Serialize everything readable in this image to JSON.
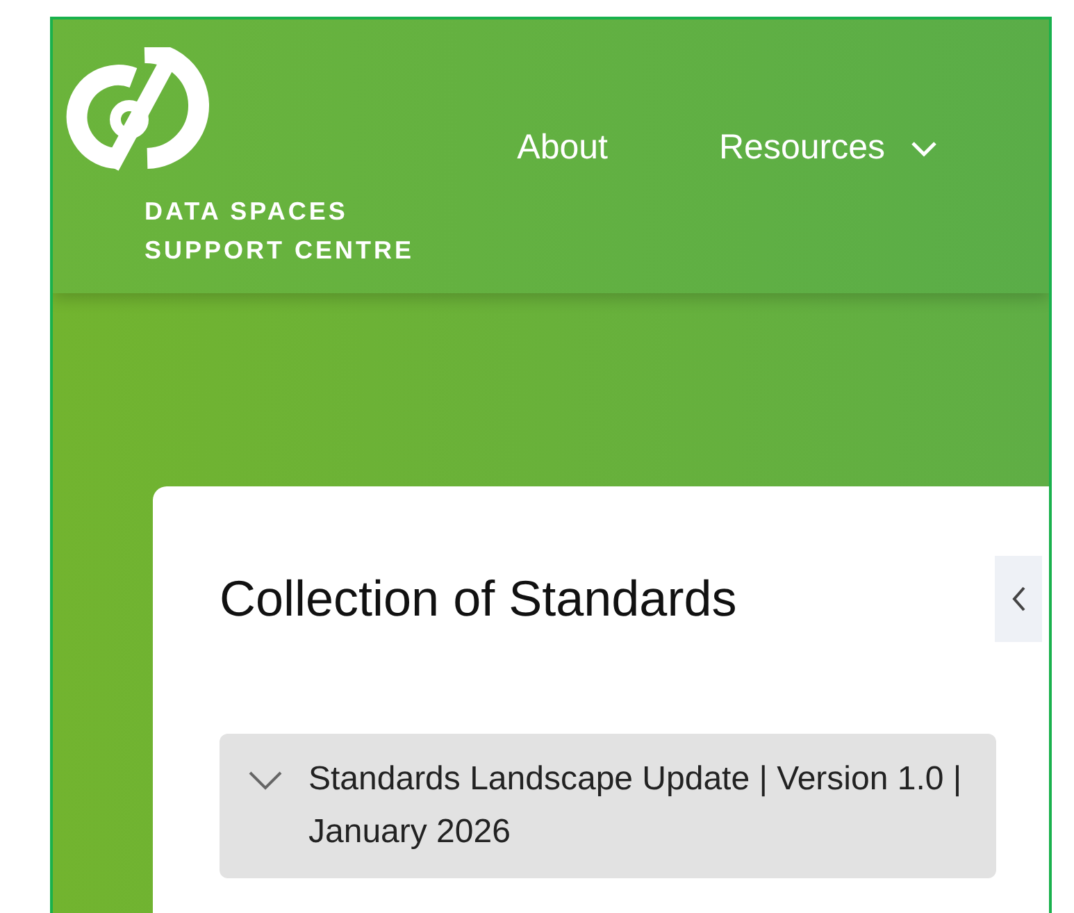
{
  "header": {
    "logo_text": [
      "DATA SPACES",
      "SUPPORT CENTRE"
    ],
    "nav": [
      {
        "label": "About",
        "kind": "link"
      },
      {
        "label": "Resources",
        "kind": "dropdown"
      }
    ]
  },
  "card": {
    "title": "Collection of Standards",
    "accordion": [
      {
        "label": "Standards Landscape Update | Version 1.0 | January 2026",
        "expanded": false
      }
    ]
  }
}
